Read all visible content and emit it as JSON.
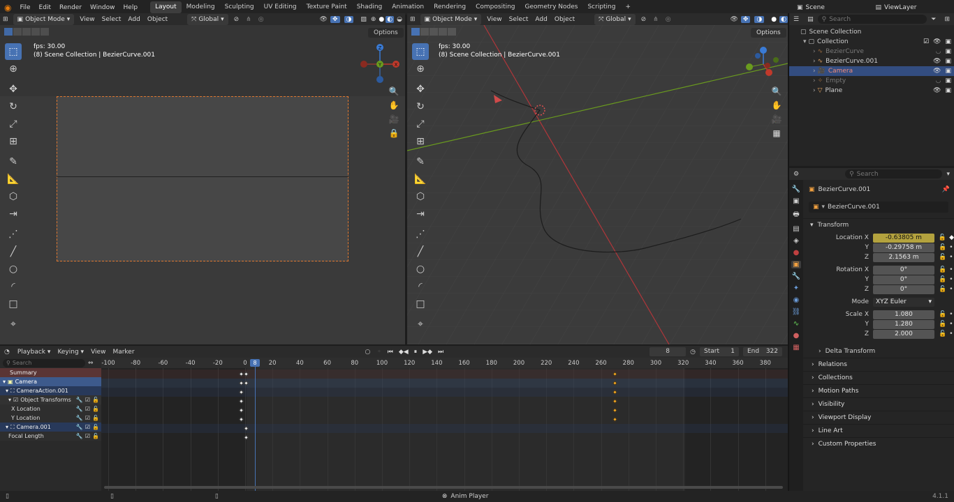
{
  "app": {
    "menus": [
      "File",
      "Edit",
      "Render",
      "Window",
      "Help"
    ],
    "workspaces": [
      "Layout",
      "Modeling",
      "Sculpting",
      "UV Editing",
      "Texture Paint",
      "Shading",
      "Animation",
      "Rendering",
      "Compositing",
      "Geometry Nodes",
      "Scripting"
    ],
    "active_workspace": "Layout",
    "add_workspace": "+",
    "scene": "Scene",
    "view_layer": "ViewLayer"
  },
  "viewport_left": {
    "mode": "Object Mode",
    "menus": [
      "View",
      "Select",
      "Add",
      "Object"
    ],
    "orientation": "Global",
    "options": "Options",
    "fps": "fps: 30.00",
    "info": "(8) Scene Collection | BezierCurve.001"
  },
  "viewport_right": {
    "mode": "Object Mode",
    "menus": [
      "View",
      "Select",
      "Add",
      "Object"
    ],
    "orientation": "Global",
    "options": "Options",
    "fps": "fps: 30.00",
    "info": "(8) Scene Collection | BezierCurve.001"
  },
  "gizmo": {
    "x": "X",
    "y": "Y",
    "z": "Z"
  },
  "outliner": {
    "search_placeholder": "Search",
    "root": "Scene Collection",
    "collection": "Collection",
    "items": [
      {
        "name": "BezierCurve",
        "dim": true,
        "selected": false
      },
      {
        "name": "BezierCurve.001",
        "dim": false,
        "selected": false
      },
      {
        "name": "Camera",
        "dim": false,
        "selected": true
      },
      {
        "name": "Empty",
        "dim": true,
        "selected": false
      },
      {
        "name": "Plane",
        "dim": false,
        "selected": false
      }
    ]
  },
  "properties": {
    "search_placeholder": "Search",
    "object_name": "BezierCurve.001",
    "datablock_name": "BezierCurve.001",
    "transform_label": "Transform",
    "location": {
      "label_x": "Location X",
      "label_y": "Y",
      "label_z": "Z",
      "x": "-0.63805 m",
      "y": "-0.29758 m",
      "z": "2.1563 m"
    },
    "rotation": {
      "label_x": "Rotation X",
      "label_y": "Y",
      "label_z": "Z",
      "x": "0°",
      "y": "0°",
      "z": "0°"
    },
    "mode_label": "Mode",
    "mode_value": "XYZ Euler",
    "scale": {
      "label_x": "Scale X",
      "label_y": "Y",
      "label_z": "Z",
      "x": "1.080",
      "y": "1.280",
      "z": "2.000"
    },
    "delta_transform": "Delta Transform",
    "panels": [
      "Relations",
      "Collections",
      "Motion Paths",
      "Visibility",
      "Viewport Display",
      "Line Art",
      "Custom Properties"
    ]
  },
  "timeline": {
    "menus": [
      "Playback",
      "Keying",
      "View",
      "Marker"
    ],
    "current_frame": "8",
    "start_label": "Start",
    "start": "1",
    "end_label": "End",
    "end": "322",
    "search_placeholder": "Search",
    "ticks": [
      "-100",
      "-80",
      "-60",
      "-40",
      "-20",
      "0",
      "20",
      "40",
      "60",
      "80",
      "100",
      "120",
      "140",
      "160",
      "180",
      "200",
      "220",
      "240",
      "260",
      "280",
      "300",
      "320",
      "340",
      "360",
      "380"
    ],
    "playhead_frame": "8",
    "channels": [
      {
        "name": "Summary",
        "kind": "summary"
      },
      {
        "name": "Camera",
        "kind": "object"
      },
      {
        "name": "CameraAction.001",
        "kind": "action"
      },
      {
        "name": "Object Transforms",
        "kind": "group"
      },
      {
        "name": "X Location",
        "kind": "fcurve"
      },
      {
        "name": "Y Location",
        "kind": "fcurve"
      },
      {
        "name": "Camera.001",
        "kind": "action"
      },
      {
        "name": "Focal Length",
        "kind": "fcurve"
      }
    ]
  },
  "statusbar": {
    "center": "Anim Player",
    "version": "4.1.1"
  },
  "colors": {
    "accent": "#4772b3",
    "selected_row": "#334d80",
    "keyframe_field": "#b3a23e",
    "keyframe_selected": "#f2a51f",
    "x_axis": "#c0392b",
    "y_axis": "#6a9b1e"
  }
}
